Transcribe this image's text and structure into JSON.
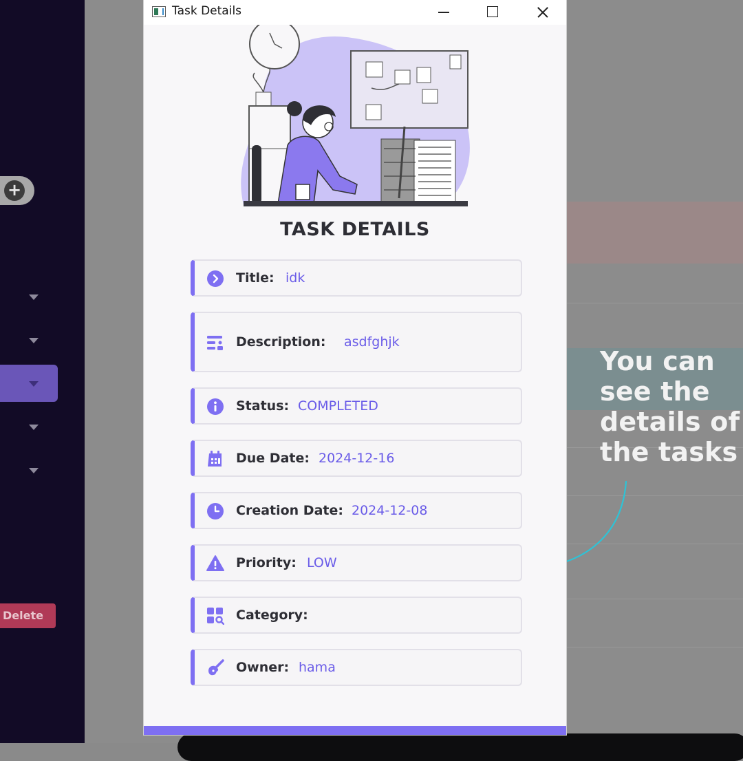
{
  "window": {
    "title": "Task Details",
    "controls": [
      "minimize",
      "maximize",
      "close"
    ]
  },
  "heading": "TASK DETAILS",
  "fields": [
    {
      "icon": "chevron-right-circle-icon",
      "label": "Title:",
      "value": "idk"
    },
    {
      "icon": "description-list-icon",
      "label": "Description:",
      "value": "asdfghjk"
    },
    {
      "icon": "info-icon",
      "label": "Status:",
      "value": "COMPLETED"
    },
    {
      "icon": "calendar-icon",
      "label": "Due Date:",
      "value": "2024-12-16"
    },
    {
      "icon": "clock-icon",
      "label": "Creation Date:",
      "value": "2024-12-08"
    },
    {
      "icon": "warning-icon",
      "label": "Priority:",
      "value": "LOW"
    },
    {
      "icon": "category-grid-icon",
      "label": "Category:",
      "value": ""
    },
    {
      "icon": "guitar-icon",
      "label": "Owner:",
      "value": "hama"
    }
  ],
  "background": {
    "add_glyph": "+",
    "delete_label": "Delete"
  },
  "annotation": "You can\nsee the\ndetails of\nthe tasks",
  "colors": {
    "accent": "#7e6ff2",
    "value_text": "#6a5ce8",
    "sidebar": "#120b26",
    "active_item": "#6a56b8",
    "delete": "#b03a57",
    "arrow": "#2ec3d6"
  }
}
